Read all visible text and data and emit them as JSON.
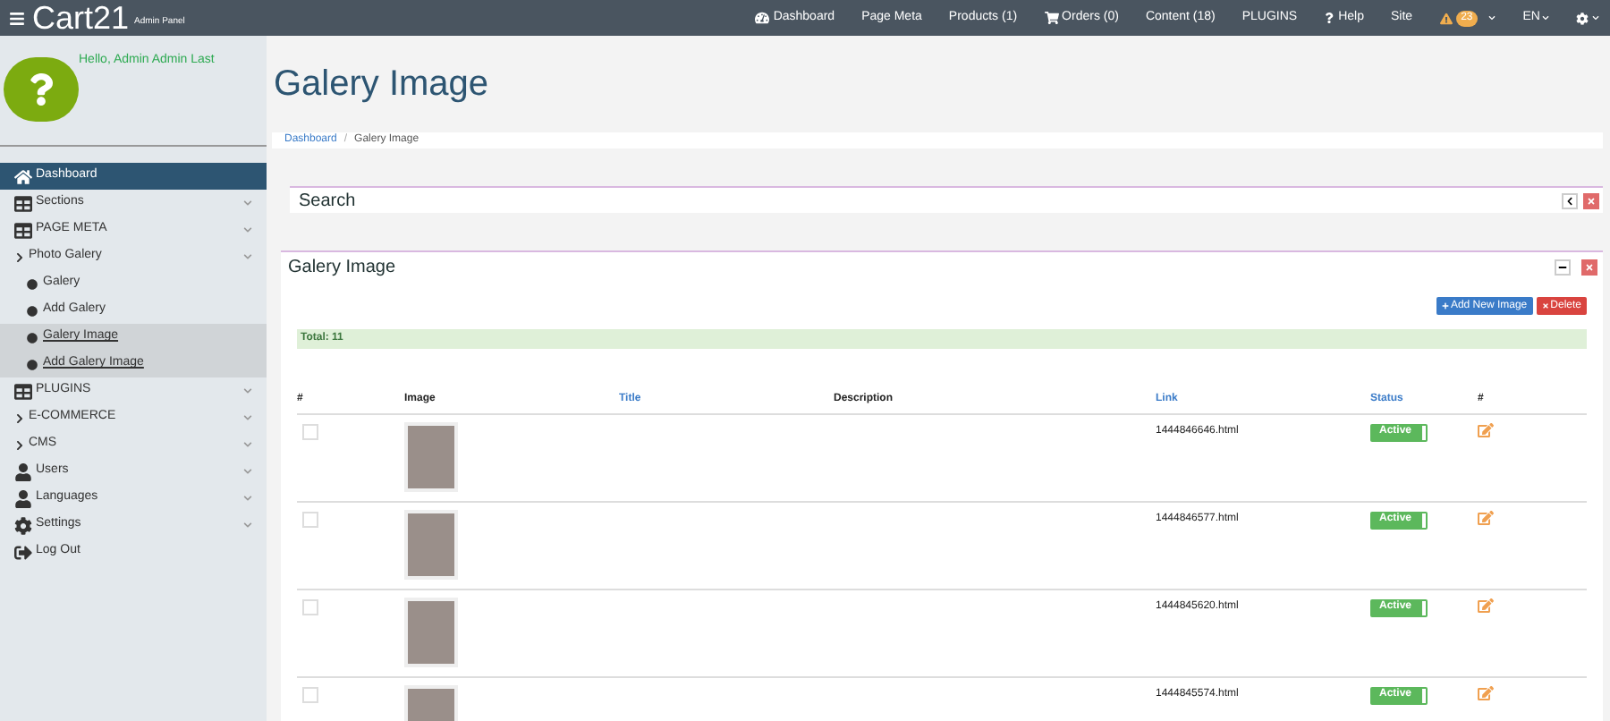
{
  "brand": {
    "name": "Cart21",
    "subtitle": "Admin Panel"
  },
  "topnav": [
    {
      "label": "Dashboard",
      "kind": "dashboard"
    },
    {
      "label": "Page Meta",
      "kind": "plain"
    },
    {
      "label": "Products (1)",
      "kind": "plain"
    },
    {
      "label": "Orders (0)",
      "kind": "cart"
    },
    {
      "label": "Content (18)",
      "kind": "plain"
    },
    {
      "label": "PLUGINS",
      "kind": "plain"
    },
    {
      "label": "Help",
      "kind": "help"
    },
    {
      "label": "Site",
      "kind": "plain"
    }
  ],
  "alerts": {
    "count": "23"
  },
  "language": {
    "label": "EN"
  },
  "user": {
    "greeting": "Hello, Admin Admin Last"
  },
  "sidebar": {
    "items": [
      {
        "label": "Dashboard",
        "kind": "home",
        "selected": true,
        "expandable": false
      },
      {
        "label": "Sections",
        "kind": "table",
        "selected": false,
        "expandable": true
      },
      {
        "label": "PAGE META",
        "kind": "table",
        "selected": false,
        "expandable": true
      },
      {
        "label": "Photo Galery",
        "kind": "folder",
        "selected": false,
        "expandable": true,
        "children": [
          {
            "label": "Galery",
            "highlighted": false
          },
          {
            "label": "Add Galery",
            "highlighted": false
          },
          {
            "label": "Galery Image",
            "highlighted": true
          },
          {
            "label": "Add Galery Image",
            "highlighted": true
          }
        ]
      },
      {
        "label": "PLUGINS",
        "kind": "table",
        "selected": false,
        "expandable": true
      },
      {
        "label": "E-COMMERCE",
        "kind": "folder",
        "selected": false,
        "expandable": true
      },
      {
        "label": "CMS",
        "kind": "folder",
        "selected": false,
        "expandable": true
      },
      {
        "label": "Users",
        "kind": "user",
        "selected": false,
        "expandable": true
      },
      {
        "label": "Languages",
        "kind": "user",
        "selected": false,
        "expandable": true
      },
      {
        "label": "Settings",
        "kind": "settings",
        "selected": false,
        "expandable": true
      },
      {
        "label": "Log Out",
        "kind": "logout",
        "selected": false,
        "expandable": false
      }
    ]
  },
  "page": {
    "title": "Galery Image",
    "separator": "/",
    "breadcrumb": [
      "Dashboard",
      "Galery Image"
    ]
  },
  "search_panel": {
    "title": "Search"
  },
  "gallery_panel": {
    "title": "Galery Image",
    "add_button": "Add New Image",
    "delete_button": "Delete",
    "total": "Total: 11",
    "columns": [
      {
        "label": "#",
        "link": false
      },
      {
        "label": "Image",
        "link": false
      },
      {
        "label": "Title",
        "link": true
      },
      {
        "label": "Description",
        "link": false
      },
      {
        "label": "Link",
        "link": true
      },
      {
        "label": "Status",
        "link": true
      },
      {
        "label": "#",
        "link": false
      }
    ],
    "rows": [
      {
        "checked": false,
        "link": "1444846646.html",
        "status": "Active",
        "on": true
      },
      {
        "checked": false,
        "link": "1444846577.html",
        "status": "Active",
        "on": true
      },
      {
        "checked": false,
        "link": "1444845620.html",
        "status": "Active",
        "on": true
      },
      {
        "checked": false,
        "link": "1444845574.html",
        "status": "Active",
        "on": true
      }
    ]
  }
}
